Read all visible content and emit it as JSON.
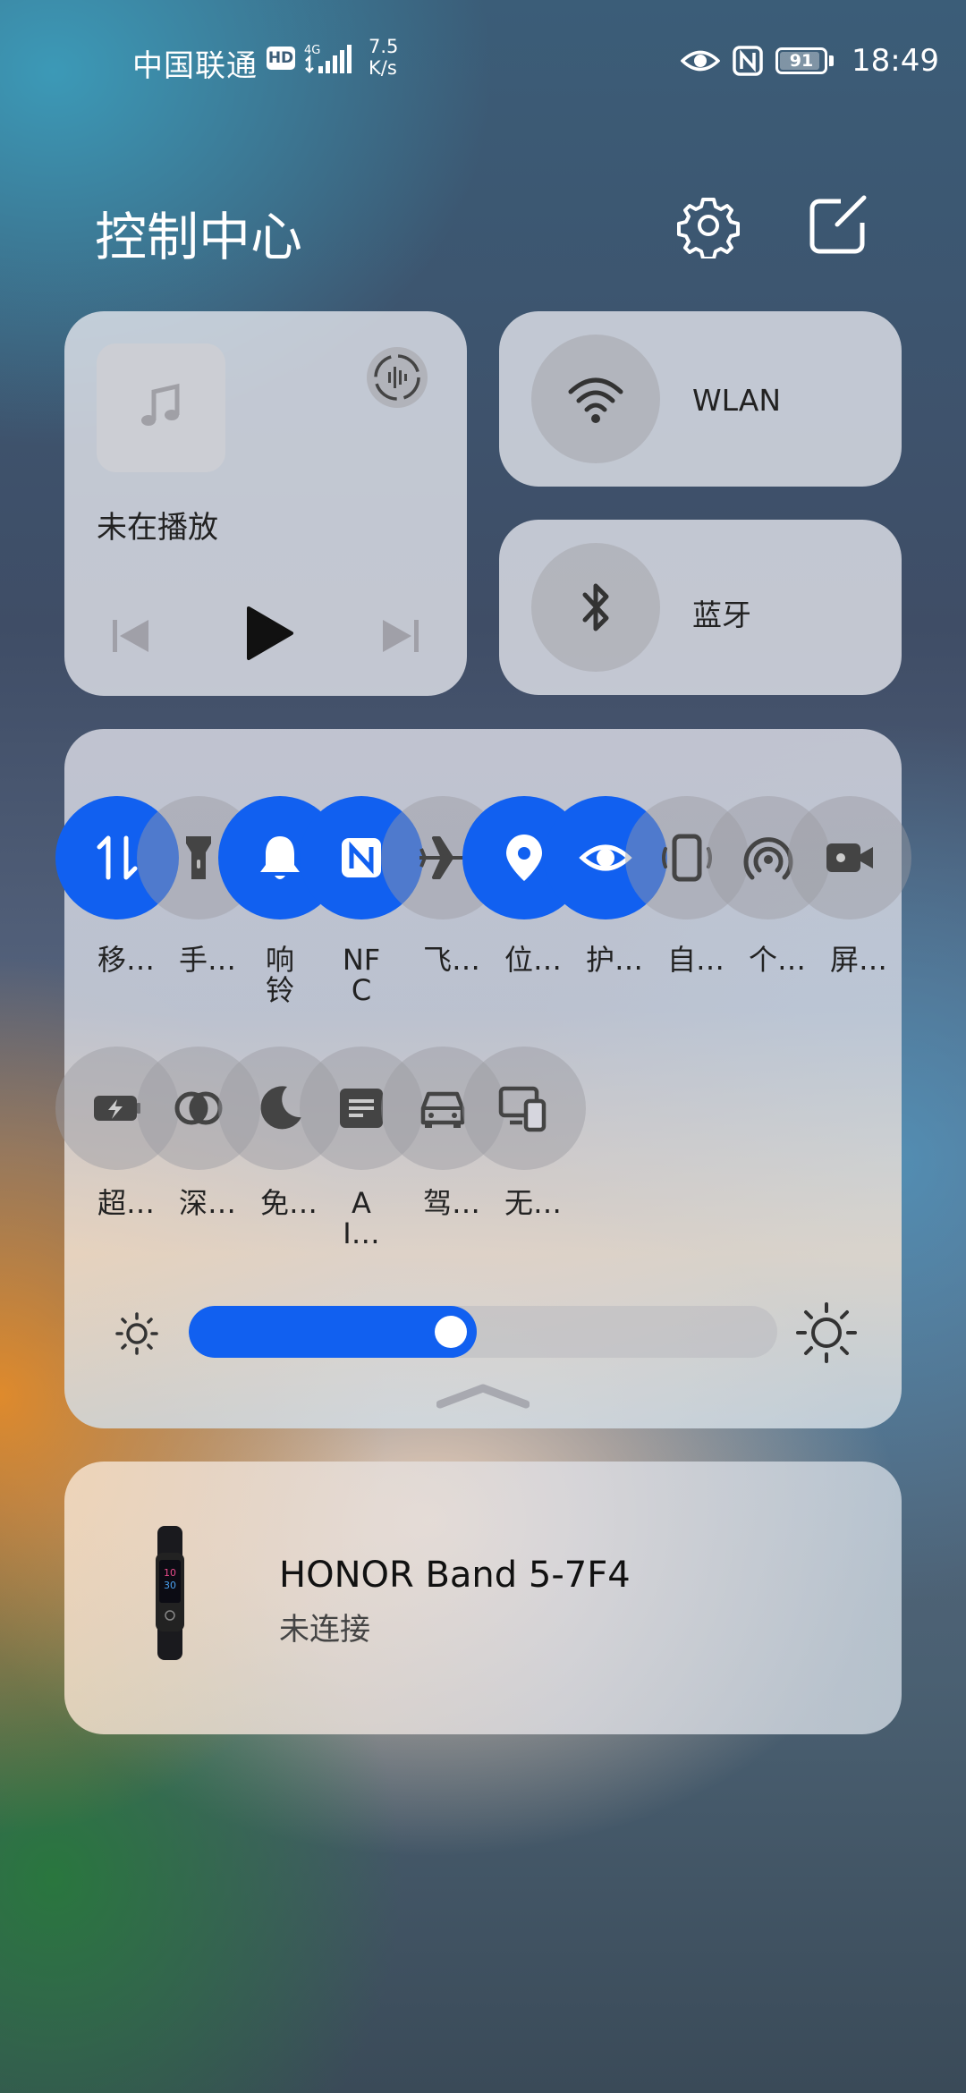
{
  "status_bar": {
    "carrier": "中国联通",
    "hd_badge": "HD",
    "network_type": "4G",
    "net_speed_value": "7.5",
    "net_speed_unit": "K/s",
    "battery_level": "91",
    "time": "18:49",
    "icons": [
      "eye-icon",
      "nfc-icon",
      "battery-icon"
    ]
  },
  "header": {
    "title": "控制中心",
    "settings_icon": "gear-icon",
    "edit_icon": "edit-icon"
  },
  "media": {
    "status": "未在播放",
    "icons": [
      "music-note-icon",
      "audio-output-icon",
      "previous-icon",
      "play-icon",
      "next-icon"
    ]
  },
  "connectivity": [
    {
      "label": "WLAN",
      "icon": "wifi-icon"
    },
    {
      "label": "蓝牙",
      "icon": "bluetooth-icon"
    }
  ],
  "tiles": {
    "row1": [
      {
        "label": "移…",
        "icon": "mobile-data-icon",
        "active": true
      },
      {
        "label": "手…",
        "icon": "flashlight-icon",
        "active": false
      },
      {
        "label": "响铃",
        "icon": "bell-icon",
        "active": true
      },
      {
        "label": "NFC",
        "icon": "nfc-icon",
        "active": true
      },
      {
        "label": "飞…",
        "icon": "airplane-icon",
        "active": false
      },
      {
        "label": "位…",
        "icon": "location-icon",
        "active": true
      },
      {
        "label": "护…",
        "icon": "eye-comfort-icon",
        "active": true
      },
      {
        "label": "自…",
        "icon": "auto-rotate-icon",
        "active": false
      },
      {
        "label": "个…",
        "icon": "hotspot-icon",
        "active": false
      },
      {
        "label": "屏…",
        "icon": "screen-record-icon",
        "active": false
      }
    ],
    "row2": [
      {
        "label": "超…",
        "icon": "power-saving-icon",
        "active": false
      },
      {
        "label": "深…",
        "icon": "dark-mode-icon",
        "active": false
      },
      {
        "label": "免…",
        "icon": "do-not-disturb-icon",
        "active": false
      },
      {
        "label": "AI…",
        "icon": "ai-subtitle-icon",
        "active": false
      },
      {
        "label": "驾…",
        "icon": "driving-mode-icon",
        "active": false
      },
      {
        "label": "无…",
        "icon": "wireless-projection-icon",
        "active": false
      }
    ]
  },
  "brightness": {
    "level": 0.49,
    "icons": [
      "brightness-low-icon",
      "brightness-high-icon"
    ]
  },
  "device": {
    "name": "HONOR Band 5-7F4",
    "status": "未连接",
    "icon": "smart-band-icon"
  },
  "colors": {
    "accent": "#1160f0",
    "card": "#e8e9f0",
    "inactive_tile": "#9b9ca2"
  }
}
